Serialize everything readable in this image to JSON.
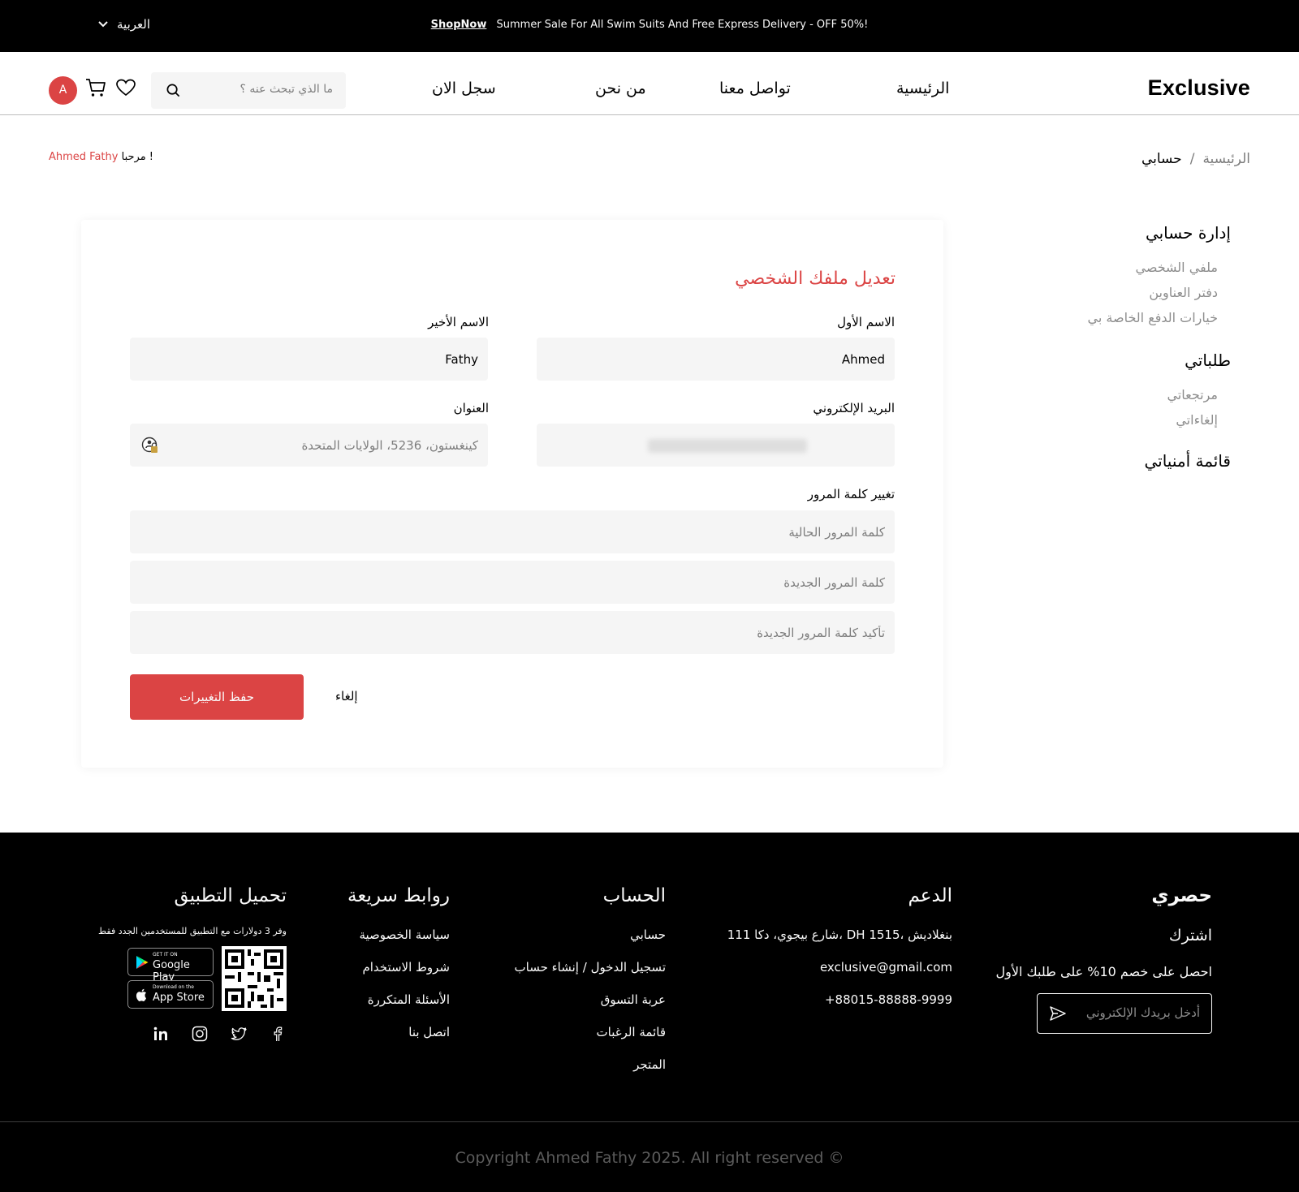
{
  "topbar": {
    "promo_text": "Summer Sale For All Swim Suits And Free Express Delivery - OFF 50%!",
    "shop_now": "ShopNow",
    "language": "العربية"
  },
  "header": {
    "logo": "Exclusive",
    "nav": [
      "الرئيسية",
      "تواصل معنا",
      "من نحن",
      "سجل الان"
    ],
    "search_placeholder": "ما الذي تبحث عنه ؟",
    "avatar_letter": "A"
  },
  "breadcrumb": {
    "home": "الرئيسية",
    "separator": "/",
    "current": "حسابي"
  },
  "welcome": {
    "greeting": "مرحبا !",
    "name": "Ahmed Fathy"
  },
  "side_menu": {
    "manage_account": "إدارة حسابي",
    "profile": "ملفي الشخصي",
    "address_book": "دفتر العناوين",
    "payment_options": "خيارات الدفع الخاصة بي",
    "my_orders": "طلباتي",
    "returns": "مرتجعاتي",
    "cancellations": "إلغاءاتي",
    "wishlist": "قائمة أمنياتي"
  },
  "form": {
    "title": "تعديل ملفك الشخصي",
    "first_name_label": "الاسم الأول",
    "first_name_value": "Ahmed",
    "last_name_label": "الاسم الأخير",
    "last_name_value": "Fathy",
    "email_label": "البريد الإلكتروني",
    "address_label": "العنوان",
    "address_placeholder": "كينغستون، 5236، الولايات المتحدة",
    "password_label": "تغيير كلمة المرور",
    "current_password_placeholder": "كلمة المرور الحالية",
    "new_password_placeholder": "كلمة المرور الجديدة",
    "confirm_password_placeholder": "تأكيد كلمة المرور الجديدة",
    "save_button": "حفظ التغييرات",
    "cancel_button": "إلغاء"
  },
  "footer": {
    "exclusive": {
      "title": "حصري",
      "subscribe": "اشترك",
      "offer": "احصل على خصم 10% على طلبك الأول",
      "email_placeholder": "أدخل بريدك الإلكتروني"
    },
    "support": {
      "title": "الدعم",
      "address": "111 شارع بيجوي، دكا، DH 1515، بنغلاديش",
      "email": "exclusive@gmail.com",
      "phone": "+88015-88888-9999"
    },
    "account": {
      "title": "الحساب",
      "links": [
        "حسابي",
        "تسجيل الدخول / إنشاء حساب",
        "عربة التسوق",
        "قائمة الرغبات",
        "المتجر"
      ]
    },
    "quick_links": {
      "title": "روابط سريعة",
      "links": [
        "سياسة الخصوصية",
        "شروط الاستخدام",
        "الأسئلة المتكررة",
        "اتصل بنا"
      ]
    },
    "app": {
      "title": "تحميل التطبيق",
      "note": "وفر 3 دولارات مع التطبيق للمستخدمين الجدد فقط",
      "google_small": "GET IT ON",
      "google_big": "Google Play",
      "apple_small": "Download on the",
      "apple_big": "App Store"
    },
    "copyright": "Copyright Ahmed Fathy 2025. All right reserved"
  },
  "colors": {
    "accent": "#DB4444",
    "dark": "#000000",
    "field_bg": "#F5F5F5"
  }
}
